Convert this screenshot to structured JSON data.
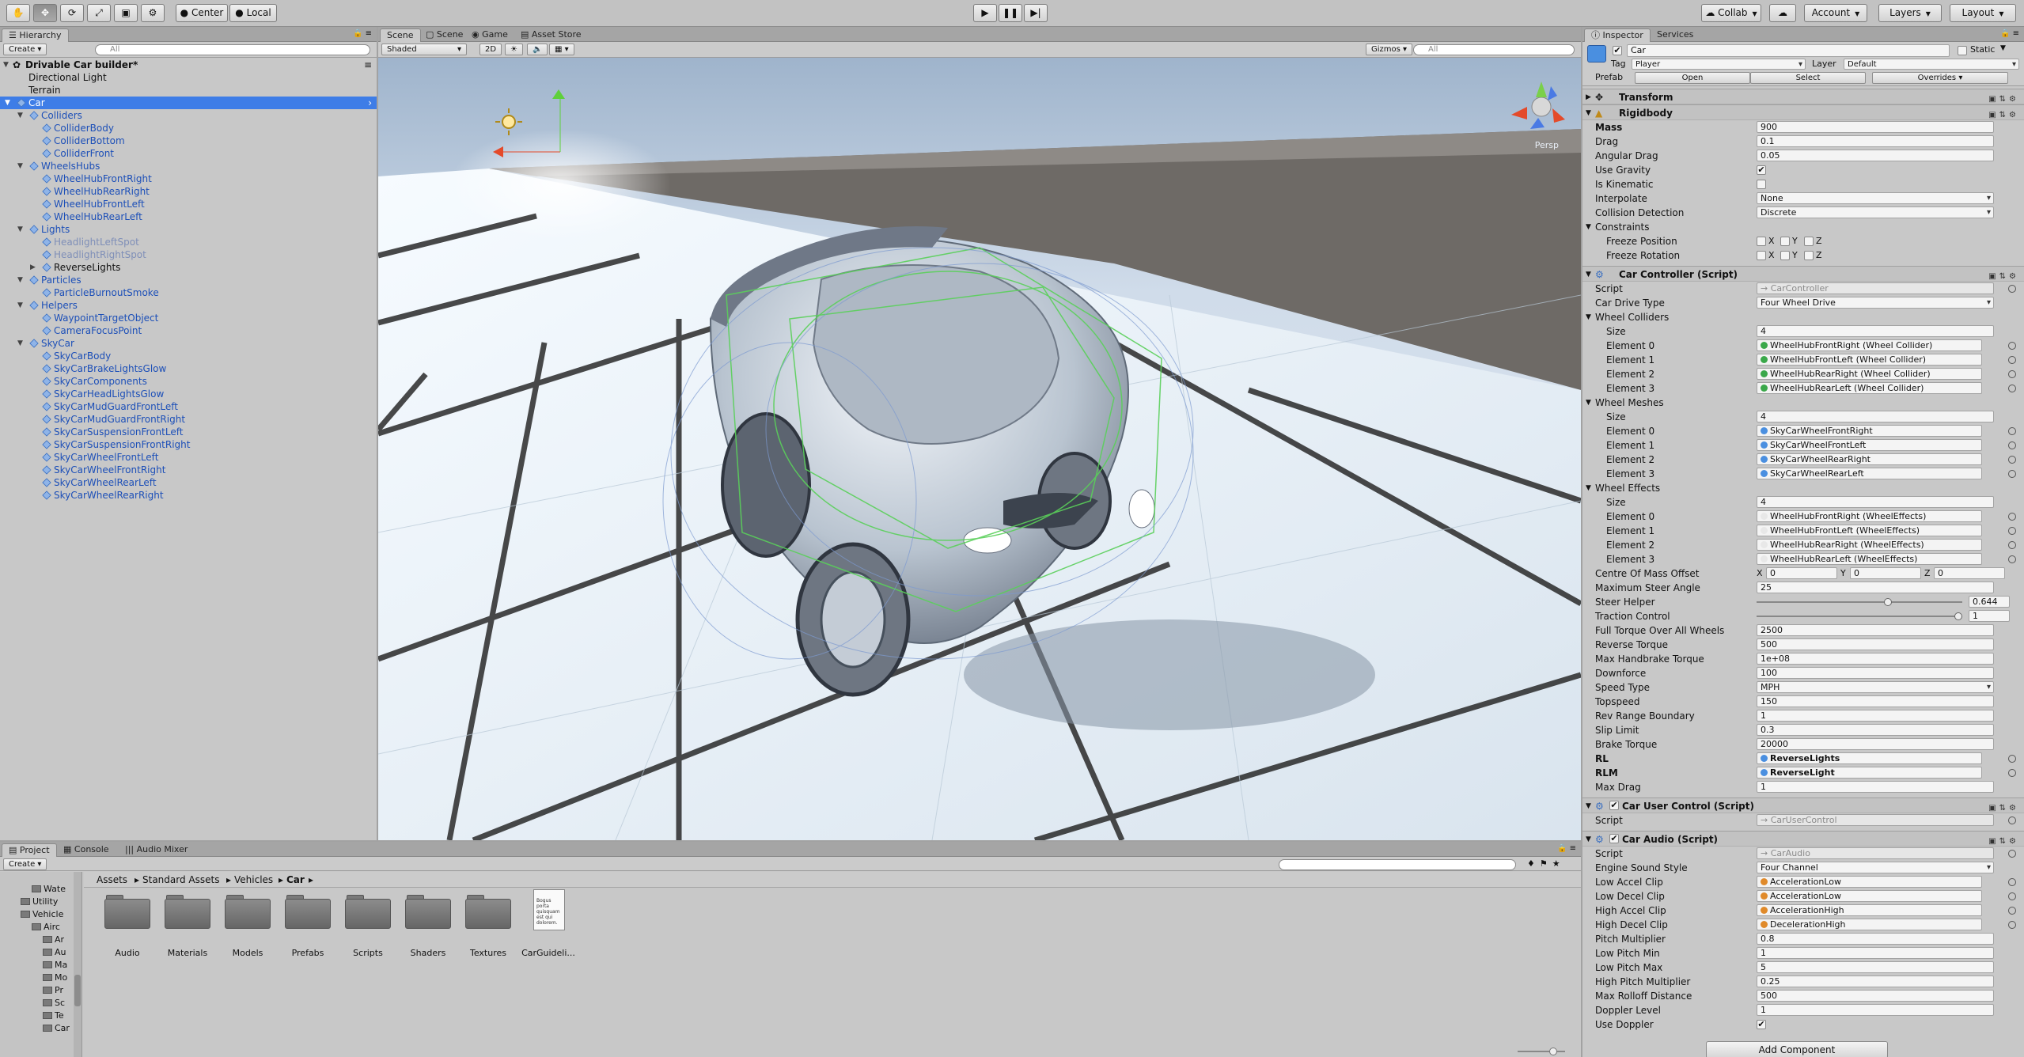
{
  "toolbar": {
    "center_label": "Center",
    "local_label": "Local",
    "collab_label": "Collab",
    "account_label": "Account",
    "layers_label": "Layers",
    "layout_label": "Layout"
  },
  "hierarchy": {
    "tab_label": "Hierarchy",
    "create_label": "Create",
    "search_placeholder": "All",
    "scene_name": "Drivable Car builder*",
    "items": [
      {
        "label": "Directional Light",
        "depth": 1,
        "style": "normal",
        "arrow": ""
      },
      {
        "label": "Terrain",
        "depth": 1,
        "style": "normal",
        "arrow": ""
      },
      {
        "label": "Car",
        "depth": 1,
        "style": "selected",
        "arrow": "open"
      },
      {
        "label": "Colliders",
        "depth": 2,
        "style": "blue",
        "arrow": "open"
      },
      {
        "label": "ColliderBody",
        "depth": 3,
        "style": "blue",
        "arrow": ""
      },
      {
        "label": "ColliderBottom",
        "depth": 3,
        "style": "blue",
        "arrow": ""
      },
      {
        "label": "ColliderFront",
        "depth": 3,
        "style": "blue",
        "arrow": ""
      },
      {
        "label": "WheelsHubs",
        "depth": 2,
        "style": "blue",
        "arrow": "open"
      },
      {
        "label": "WheelHubFrontRight",
        "depth": 3,
        "style": "blue",
        "arrow": ""
      },
      {
        "label": "WheelHubRearRight",
        "depth": 3,
        "style": "blue",
        "arrow": ""
      },
      {
        "label": "WheelHubFrontLeft",
        "depth": 3,
        "style": "blue",
        "arrow": ""
      },
      {
        "label": "WheelHubRearLeft",
        "depth": 3,
        "style": "blue",
        "arrow": ""
      },
      {
        "label": "Lights",
        "depth": 2,
        "style": "blue",
        "arrow": "open"
      },
      {
        "label": "HeadlightLeftSpot",
        "depth": 3,
        "style": "gray",
        "arrow": ""
      },
      {
        "label": "HeadlightRightSpot",
        "depth": 3,
        "style": "gray",
        "arrow": ""
      },
      {
        "label": "ReverseLights",
        "depth": 3,
        "style": "normal",
        "arrow": "closed"
      },
      {
        "label": "Particles",
        "depth": 2,
        "style": "blue",
        "arrow": "open"
      },
      {
        "label": "ParticleBurnoutSmoke",
        "depth": 3,
        "style": "blue",
        "arrow": ""
      },
      {
        "label": "Helpers",
        "depth": 2,
        "style": "blue",
        "arrow": "open"
      },
      {
        "label": "WaypointTargetObject",
        "depth": 3,
        "style": "blue",
        "arrow": ""
      },
      {
        "label": "CameraFocusPoint",
        "depth": 3,
        "style": "blue",
        "arrow": ""
      },
      {
        "label": "SkyCar",
        "depth": 2,
        "style": "blue",
        "arrow": "open"
      },
      {
        "label": "SkyCarBody",
        "depth": 3,
        "style": "blue",
        "arrow": ""
      },
      {
        "label": "SkyCarBrakeLightsGlow",
        "depth": 3,
        "style": "blue",
        "arrow": ""
      },
      {
        "label": "SkyCarComponents",
        "depth": 3,
        "style": "blue",
        "arrow": ""
      },
      {
        "label": "SkyCarHeadLightsGlow",
        "depth": 3,
        "style": "blue",
        "arrow": ""
      },
      {
        "label": "SkyCarMudGuardFrontLeft",
        "depth": 3,
        "style": "blue",
        "arrow": ""
      },
      {
        "label": "SkyCarMudGuardFrontRight",
        "depth": 3,
        "style": "blue",
        "arrow": ""
      },
      {
        "label": "SkyCarSuspensionFrontLeft",
        "depth": 3,
        "style": "blue",
        "arrow": ""
      },
      {
        "label": "SkyCarSuspensionFrontRight",
        "depth": 3,
        "style": "blue",
        "arrow": ""
      },
      {
        "label": "SkyCarWheelFrontLeft",
        "depth": 3,
        "style": "blue",
        "arrow": ""
      },
      {
        "label": "SkyCarWheelFrontRight",
        "depth": 3,
        "style": "blue",
        "arrow": ""
      },
      {
        "label": "SkyCarWheelRearLeft",
        "depth": 3,
        "style": "blue",
        "arrow": ""
      },
      {
        "label": "SkyCarWheelRearRight",
        "depth": 3,
        "style": "blue",
        "arrow": ""
      }
    ]
  },
  "scene": {
    "tabs": [
      "Scene",
      "Scene",
      "Game",
      "Asset Store"
    ],
    "shading_mode": "Shaded",
    "mode_2d": "2D",
    "gizmos_label": "Gizmos",
    "search_placeholder": "All",
    "view_label": "Persp"
  },
  "project": {
    "tabs": [
      "Project",
      "Console",
      "Audio Mixer"
    ],
    "create_label": "Create",
    "breadcrumb": [
      "Assets",
      "Standard Assets",
      "Vehicles",
      "Car"
    ],
    "tree_items": [
      "Wate",
      "Utility",
      "Vehicle",
      "Airc",
      "Ar",
      "Au",
      "Ma",
      "Mo",
      "Pr",
      "Sc",
      "Te",
      "Car"
    ],
    "assets": [
      "Audio",
      "Materials",
      "Models",
      "Prefabs",
      "Scripts",
      "Shaders",
      "Textures",
      "CarGuideli..."
    ],
    "doc_preview": "Bogus porta quisquam est qui dolorem."
  },
  "inspector": {
    "tabs": [
      "Inspector",
      "Services"
    ],
    "object_name": "Car",
    "static_label": "Static",
    "tag_label": "Tag",
    "tag_value": "Player",
    "layer_label": "Layer",
    "layer_value": "Default",
    "prefab_label": "Prefab",
    "prefab_open": "Open",
    "prefab_select": "Select",
    "prefab_overrides": "Overrides",
    "transform_title": "Transform",
    "rigidbody": {
      "title": "Rigidbody",
      "rows": [
        {
          "label": "Mass",
          "value": "900",
          "kind": "text",
          "bold": true
        },
        {
          "label": "Drag",
          "value": "0.1",
          "kind": "text"
        },
        {
          "label": "Angular Drag",
          "value": "0.05",
          "kind": "text"
        },
        {
          "label": "Use Gravity",
          "value": "✔",
          "kind": "check"
        },
        {
          "label": "Is Kinematic",
          "value": "",
          "kind": "check"
        },
        {
          "label": "Interpolate",
          "value": "None",
          "kind": "dropdown"
        },
        {
          "label": "Collision Detection",
          "value": "Discrete",
          "kind": "dropdown"
        }
      ],
      "constraints_label": "Constraints",
      "freeze_position": "Freeze Position",
      "freeze_rotation": "Freeze Rotation",
      "axes": [
        "X",
        "Y",
        "Z"
      ]
    },
    "car_controller": {
      "title": "Car Controller (Script)",
      "script_label": "Script",
      "script_value": "CarController",
      "drive_label": "Car Drive Type",
      "drive_value": "Four Wheel Drive",
      "wheel_colliders_label": "Wheel Colliders",
      "wheel_colliders": [
        "WheelHubFrontRight (Wheel Collider)",
        "WheelHubFrontLeft (Wheel Collider)",
        "WheelHubRearRight (Wheel Collider)",
        "WheelHubRearLeft (Wheel Collider)"
      ],
      "wheel_meshes_label": "Wheel Meshes",
      "wheel_meshes": [
        "SkyCarWheelFrontRight",
        "SkyCarWheelFrontLeft",
        "SkyCarWheelRearRight",
        "SkyCarWheelRearLeft"
      ],
      "wheel_effects_label": "Wheel Effects",
      "wheel_effects": [
        "WheelHubFrontRight (WheelEffects)",
        "WheelHubFrontLeft (WheelEffects)",
        "WheelHubRearRight (WheelEffects)",
        "WheelHubRearLeft (WheelEffects)"
      ],
      "size_label": "Size",
      "size_value": "4",
      "element_labels": [
        "Element 0",
        "Element 1",
        "Element 2",
        "Element 3"
      ],
      "com_label": "Centre Of Mass Offset",
      "com_x": "0",
      "com_y": "0",
      "com_z": "0",
      "steer_angle_label": "Maximum Steer Angle",
      "steer_angle_value": "25",
      "steer_helper_label": "Steer Helper",
      "steer_helper_value": "0.644",
      "steer_helper_fraction": 0.644,
      "traction_label": "Traction Control",
      "traction_value": "1",
      "traction_fraction": 1.0,
      "rows": [
        {
          "label": "Full Torque Over All Wheels",
          "value": "2500",
          "kind": "text"
        },
        {
          "label": "Reverse Torque",
          "value": "500",
          "kind": "text"
        },
        {
          "label": "Max Handbrake Torque",
          "value": "1e+08",
          "kind": "text"
        },
        {
          "label": "Downforce",
          "value": "100",
          "kind": "text"
        },
        {
          "label": "Speed Type",
          "value": "MPH",
          "kind": "dropdown"
        },
        {
          "label": "Topspeed",
          "value": "150",
          "kind": "text"
        },
        {
          "label": "Rev Range Boundary",
          "value": "1",
          "kind": "text"
        },
        {
          "label": "Slip Limit",
          "value": "0.3",
          "kind": "text"
        },
        {
          "label": "Brake Torque",
          "value": "20000",
          "kind": "text"
        }
      ],
      "rl_label": "RL",
      "rl_value": "ReverseLights",
      "rlm_label": "RLM",
      "rlm_value": "ReverseLight",
      "max_drag_label": "Max Drag",
      "max_drag_value": "1"
    },
    "car_user_control": {
      "title": "Car User Control (Script)",
      "script_label": "Script",
      "script_value": "CarUserControl"
    },
    "car_audio": {
      "title": "Car Audio (Script)",
      "script_label": "Script",
      "script_value": "CarAudio",
      "style_label": "Engine Sound Style",
      "style_value": "Four Channel",
      "clips": [
        {
          "label": "Low Accel Clip",
          "value": "AccelerationLow"
        },
        {
          "label": "Low Decel Clip",
          "value": "AccelerationLow"
        },
        {
          "label": "High Accel Clip",
          "value": "AccelerationHigh"
        },
        {
          "label": "High Decel Clip",
          "value": "DecelerationHigh"
        }
      ],
      "rows": [
        {
          "label": "Pitch Multiplier",
          "value": "0.8"
        },
        {
          "label": "Low Pitch Min",
          "value": "1"
        },
        {
          "label": "Low Pitch Max",
          "value": "5"
        },
        {
          "label": "High Pitch Multiplier",
          "value": "0.25"
        },
        {
          "label": "Max Rolloff Distance",
          "value": "500"
        },
        {
          "label": "Doppler Level",
          "value": "1"
        }
      ],
      "doppler_use_label": "Use Doppler"
    },
    "add_component_label": "Add Component"
  },
  "colors": {
    "selection": "#3e7de7",
    "prefab_text": "#1c4fb8",
    "object_ref": "#4a8fe0",
    "audio_ref": "#e08a2a",
    "collider_ref": "#3aa84a"
  }
}
